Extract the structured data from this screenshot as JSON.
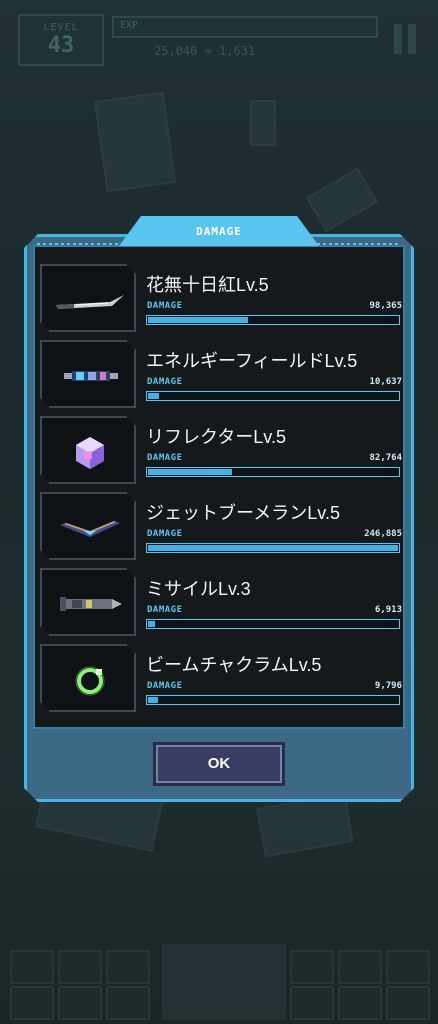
{
  "hud": {
    "level_label": "LEVEL",
    "level_value": "43",
    "exp_label": "EXP",
    "currency": "25,040  ≈ 1,631"
  },
  "modal": {
    "title": "DAMAGE",
    "ok_label": "OK",
    "accent_color": "#5ac4f0"
  },
  "weapons": [
    {
      "name": "花無十日紅Lv.5",
      "damage_label": "DAMAGE",
      "damage": "98,365",
      "icon": "katana-icon",
      "fill": 0.4
    },
    {
      "name": "エネルギーフィールドLv.5",
      "damage_label": "DAMAGE",
      "damage": "10,637",
      "icon": "energy-field-icon",
      "fill": 0.045
    },
    {
      "name": "リフレクターLv.5",
      "damage_label": "DAMAGE",
      "damage": "82,764",
      "icon": "reflector-cube-icon",
      "fill": 0.335
    },
    {
      "name": "ジェットブーメランLv.5",
      "damage_label": "DAMAGE",
      "damage": "246,885",
      "icon": "jet-boomerang-icon",
      "fill": 1.0
    },
    {
      "name": "ミサイルLv.3",
      "damage_label": "DAMAGE",
      "damage": "6,913",
      "icon": "missile-icon",
      "fill": 0.028
    },
    {
      "name": "ビームチャクラムLv.5",
      "damage_label": "DAMAGE",
      "damage": "9,796",
      "icon": "beam-chakram-icon",
      "fill": 0.04
    }
  ]
}
